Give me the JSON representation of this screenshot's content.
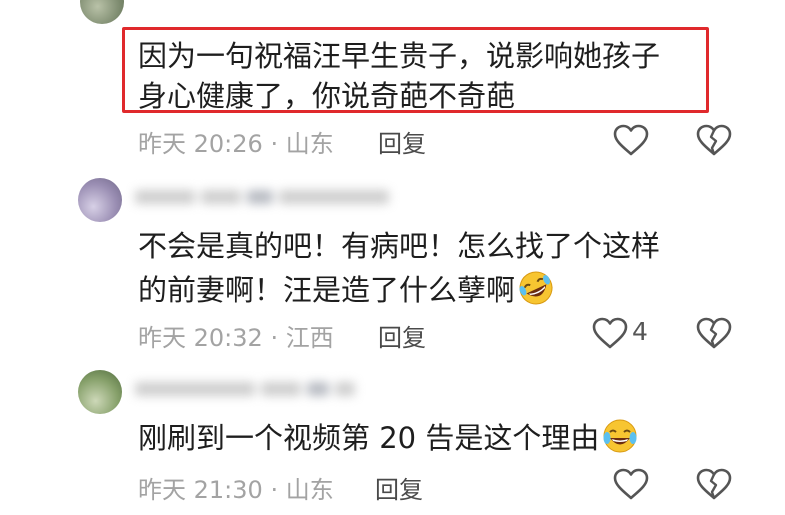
{
  "comments": [
    {
      "text_lines": [
        "因为一句祝福汪早生贵子，说影响她孩子",
        "身心健康了，你说奇葩不奇葩"
      ],
      "time": "昨天 20:26",
      "location": "山东",
      "reply_label": "回复",
      "like_count": "",
      "highlighted": true
    },
    {
      "text_lines": [
        "不会是真的吧！有病吧！怎么找了个这样",
        "的前妻啊！汪是造了什么孽啊"
      ],
      "time": "昨天 20:32",
      "location": "江西",
      "reply_label": "回复",
      "like_count": "4",
      "emoji": "rolling-laughing-emoji"
    },
    {
      "text_lines": [
        "刚刷到一个视频第 20 告是这个理由"
      ],
      "time": "昨天 21:30",
      "location": "山东",
      "reply_label": "回复",
      "like_count": "",
      "emoji": "tears-of-joy-emoji"
    }
  ],
  "meta_separator": "·",
  "colors": {
    "highlight_border": "#e0292c",
    "meta_text": "#a3a3a3",
    "body_text": "#1e1e1e"
  }
}
